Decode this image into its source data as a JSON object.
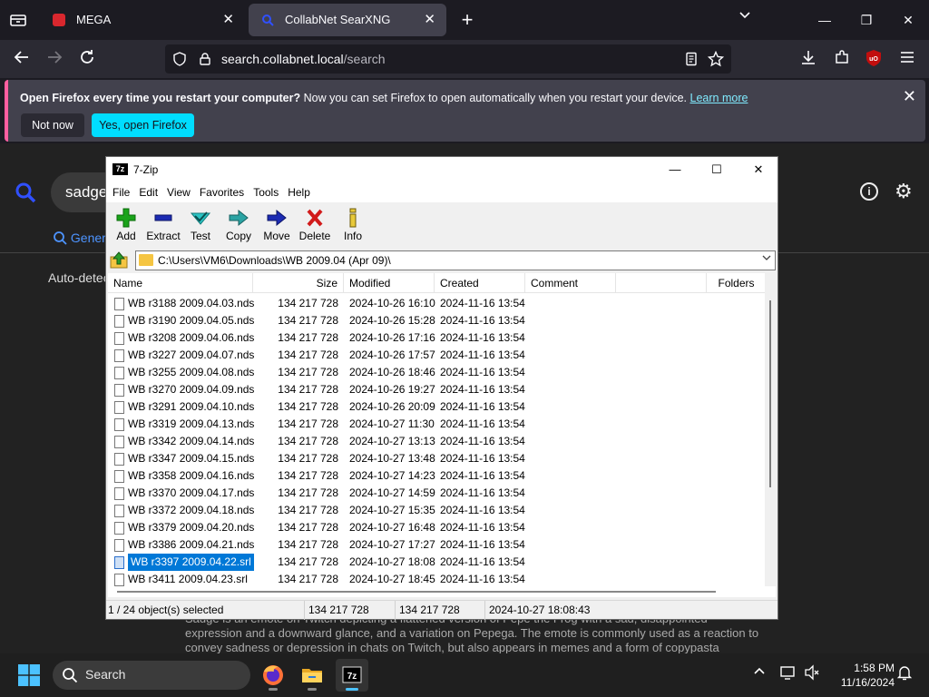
{
  "browser": {
    "tabs": [
      {
        "title": "MEGA"
      },
      {
        "title": "CollabNet SearXNG"
      }
    ],
    "url_host": "search.collabnet.local",
    "url_path": "/search",
    "notice": {
      "bold": "Open Firefox every time you restart your computer?",
      "text": " Now you can set Firefox to open automatically when you restart your device.",
      "link": "Learn more",
      "btn_not_now": "Not now",
      "btn_yes": "Yes, open Firefox"
    }
  },
  "page": {
    "query": "sadge",
    "tab_general": "General",
    "auto_detect": "Auto-detect",
    "description": "Sadge is an emote on Twitch depicting a flattened version of Pepe the Frog with a sad, disappointed expression and a downward glance, and a variation on Pepega. The emote is commonly used as a reaction to convey sadness or depression in chats on Twitch, but also appears in memes and a form of copypasta"
  },
  "sevenzip": {
    "title": "7-Zip",
    "app_icon_text": "7z",
    "menu": [
      "File",
      "Edit",
      "View",
      "Favorites",
      "Tools",
      "Help"
    ],
    "toolbar": [
      "Add",
      "Extract",
      "Test",
      "Copy",
      "Move",
      "Delete",
      "Info"
    ],
    "path": "C:\\Users\\VM6\\Downloads\\WB 2009.04 (Apr 09)\\",
    "columns": [
      "Name",
      "Size",
      "Modified",
      "Created",
      "Comment",
      "Folders"
    ],
    "files": [
      {
        "name": "WB r3188 2009.04.03.nds",
        "size": "134 217 728",
        "modified": "2024-10-26 16:10",
        "created": "2024-11-16 13:54"
      },
      {
        "name": "WB r3190 2009.04.05.nds",
        "size": "134 217 728",
        "modified": "2024-10-26 15:28",
        "created": "2024-11-16 13:54"
      },
      {
        "name": "WB r3208 2009.04.06.nds",
        "size": "134 217 728",
        "modified": "2024-10-26 17:16",
        "created": "2024-11-16 13:54"
      },
      {
        "name": "WB r3227 2009.04.07.nds",
        "size": "134 217 728",
        "modified": "2024-10-26 17:57",
        "created": "2024-11-16 13:54"
      },
      {
        "name": "WB r3255 2009.04.08.nds",
        "size": "134 217 728",
        "modified": "2024-10-26 18:46",
        "created": "2024-11-16 13:54"
      },
      {
        "name": "WB r3270 2009.04.09.nds",
        "size": "134 217 728",
        "modified": "2024-10-26 19:27",
        "created": "2024-11-16 13:54"
      },
      {
        "name": "WB r3291 2009.04.10.nds",
        "size": "134 217 728",
        "modified": "2024-10-26 20:09",
        "created": "2024-11-16 13:54"
      },
      {
        "name": "WB r3319 2009.04.13.nds",
        "size": "134 217 728",
        "modified": "2024-10-27 11:30",
        "created": "2024-11-16 13:54"
      },
      {
        "name": "WB r3342 2009.04.14.nds",
        "size": "134 217 728",
        "modified": "2024-10-27 13:13",
        "created": "2024-11-16 13:54"
      },
      {
        "name": "WB r3347 2009.04.15.nds",
        "size": "134 217 728",
        "modified": "2024-10-27 13:48",
        "created": "2024-11-16 13:54"
      },
      {
        "name": "WB r3358 2009.04.16.nds",
        "size": "134 217 728",
        "modified": "2024-10-27 14:23",
        "created": "2024-11-16 13:54"
      },
      {
        "name": "WB r3370 2009.04.17.nds",
        "size": "134 217 728",
        "modified": "2024-10-27 14:59",
        "created": "2024-11-16 13:54"
      },
      {
        "name": "WB r3372 2009.04.18.nds",
        "size": "134 217 728",
        "modified": "2024-10-27 15:35",
        "created": "2024-11-16 13:54"
      },
      {
        "name": "WB r3379 2009.04.20.nds",
        "size": "134 217 728",
        "modified": "2024-10-27 16:48",
        "created": "2024-11-16 13:54"
      },
      {
        "name": "WB r3386 2009.04.21.nds",
        "size": "134 217 728",
        "modified": "2024-10-27 17:27",
        "created": "2024-11-16 13:54"
      },
      {
        "name": "WB r3397 2009.04.22.srl",
        "size": "134 217 728",
        "modified": "2024-10-27 18:08",
        "created": "2024-11-16 13:54",
        "selected": true
      },
      {
        "name": "WB r3411 2009.04.23.srl",
        "size": "134 217 728",
        "modified": "2024-10-27 18:45",
        "created": "2024-11-16 13:54"
      }
    ],
    "status": {
      "selection": "1 / 24 object(s) selected",
      "size": "134 217 728",
      "packed": "134 217 728",
      "modified": "2024-10-27 18:08:43"
    }
  },
  "taskbar": {
    "search_label": "Search",
    "time": "1:58 PM",
    "date": "11/16/2024"
  },
  "colors": {
    "accent_firefox": "#00ddff",
    "selection_blue": "#0078d7",
    "taskbar_active": "#4cc2ff"
  }
}
